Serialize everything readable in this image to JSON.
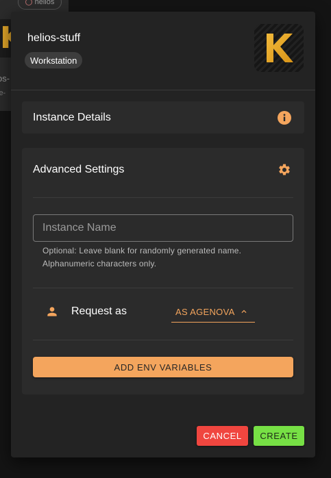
{
  "background": {
    "chip_label": "helios",
    "card_title_fragment": "os-",
    "card_subtitle_fragment": "le-",
    "logo_letter": "K"
  },
  "dialog": {
    "title": "helios-stuff",
    "chip": "Workstation",
    "logo_letter": "K",
    "details": {
      "label": "Instance Details",
      "icon": "info-icon"
    },
    "advanced": {
      "label": "Advanced Settings",
      "icon": "gear-icon",
      "instance_name": {
        "value": "",
        "placeholder": "Instance Name",
        "helper_line1": "Optional: Leave blank for randomly generated name.",
        "helper_line2": "Alphanumeric characters only."
      },
      "request_as": {
        "label": "Request as",
        "icon": "person-icon",
        "selected": "AS AGENOVA"
      },
      "env_button": "ADD ENV VARIABLES"
    },
    "actions": {
      "cancel": "CANCEL",
      "create": "CREATE"
    }
  },
  "colors": {
    "accent": "#f4a55d",
    "cancel": "#f0463f",
    "create": "#77e045",
    "logo_gold": "#e3a72a",
    "surface": "#232323",
    "panel": "#2b2b2b"
  }
}
